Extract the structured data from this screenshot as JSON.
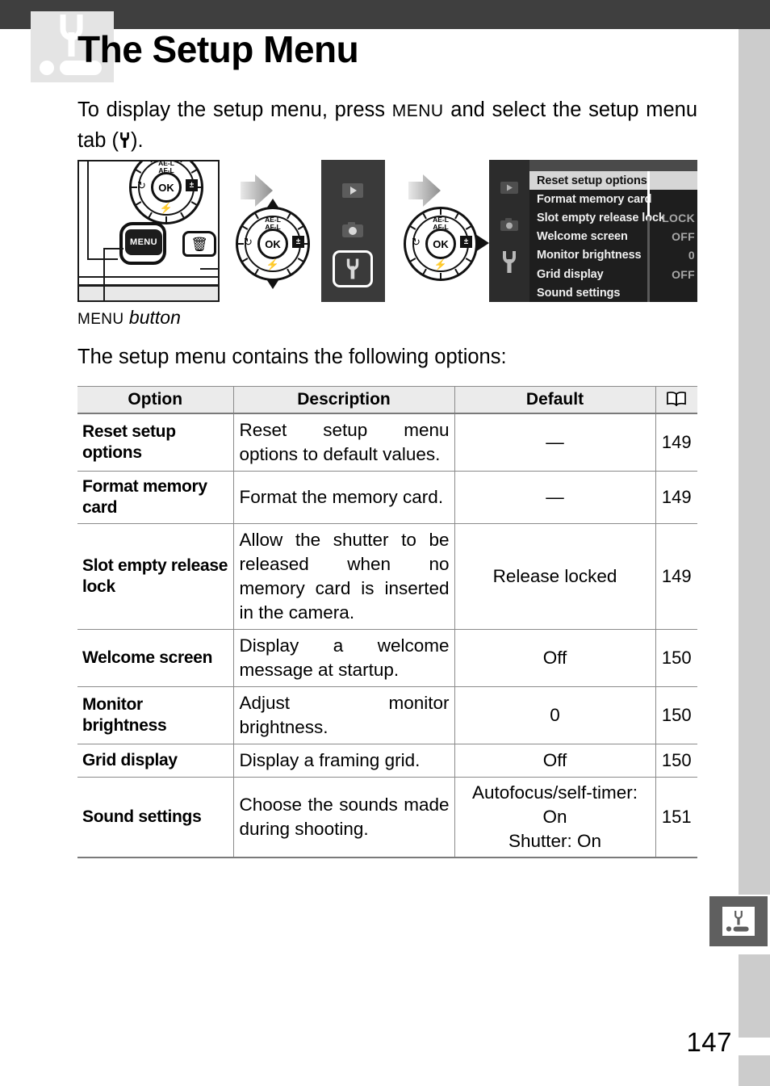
{
  "page": {
    "title": "The Setup Menu",
    "number": "147",
    "header_icon": "setup-wrench-icon",
    "side_tab_icon": "setup-wrench-icon"
  },
  "intro": {
    "part1": "To display the setup menu, press ",
    "menu_key": "MENU",
    "part2": " and select the setup menu tab (",
    "part3": ").",
    "wrench_symbol": "wrench-icon"
  },
  "figure": {
    "camera": {
      "menu_button_label": "MENU",
      "trash_icon": "trash-icon",
      "dial": {
        "ok_label": "OK",
        "ae_af_label_line1": "AE-L",
        "ae_af_label_line2": "AF-L",
        "self_timer_icon": "self-timer-icon",
        "exposure_comp_icon": "exposure-compensation-icon",
        "flash_icon": "flash-icon"
      }
    },
    "caption_key": "MENU",
    "caption_text": " button",
    "arrow_icon": "right-arrow-icon",
    "monitor_tabs": [
      {
        "name": "playback-tab",
        "icon": "playback-icon",
        "selected": false
      },
      {
        "name": "shooting-tab",
        "icon": "camera-icon",
        "selected": false
      },
      {
        "name": "setup-tab",
        "icon": "wrench-icon",
        "selected": true
      }
    ],
    "menu_screen": {
      "sidebar_icons": [
        "playback-icon",
        "camera-icon",
        "wrench-icon"
      ],
      "rows": [
        {
          "label": "Reset setup options",
          "value": "",
          "selected": true
        },
        {
          "label": "Format memory card",
          "value": "",
          "selected": false
        },
        {
          "label": "Slot empty release lock",
          "value": "LOCK",
          "selected": false
        },
        {
          "label": "Welcome screen",
          "value": "OFF",
          "selected": false
        },
        {
          "label": "Monitor brightness",
          "value": "0",
          "selected": false
        },
        {
          "label": "Grid display",
          "value": "OFF",
          "selected": false
        },
        {
          "label": "Sound settings",
          "value": "",
          "selected": false
        }
      ]
    }
  },
  "lead_in": "The setup menu contains the following options:",
  "table": {
    "headers": {
      "option": "Option",
      "description": "Description",
      "default": "Default",
      "page": "book-icon"
    },
    "rows": [
      {
        "option": "Reset setup options",
        "description": "Reset setup menu options to default values.",
        "default": "—",
        "page": "149"
      },
      {
        "option": "Format memory card",
        "description": "Format the memory card.",
        "default": "—",
        "page": "149"
      },
      {
        "option": "Slot empty release lock",
        "description": "Allow the shutter to be released when no memory card is inserted in the camera.",
        "default": "Release locked",
        "page": "149"
      },
      {
        "option": "Welcome screen",
        "description": "Display a welcome message at startup.",
        "default": "Off",
        "page": "150"
      },
      {
        "option": "Monitor brightness",
        "description": "Adjust monitor brightness.",
        "default": "0",
        "page": "150"
      },
      {
        "option": "Grid display",
        "description": "Display a framing grid.",
        "default": "Off",
        "page": "150"
      },
      {
        "option": "Sound settings",
        "description": "Choose the sounds made during shooting.",
        "default_line1": "Autofocus/self-timer:",
        "default_line2": "On",
        "default_line3": "Shutter: On",
        "page": "151"
      }
    ]
  },
  "colors": {
    "top_bar": "#3f3f3f",
    "rail": "#cccccc",
    "side_tab": "#5f5f5f",
    "header_icon_bg": "#e4e4e4",
    "table_header_bg": "#ebebeb",
    "menu_selected_bg": "#d6d6d6"
  }
}
